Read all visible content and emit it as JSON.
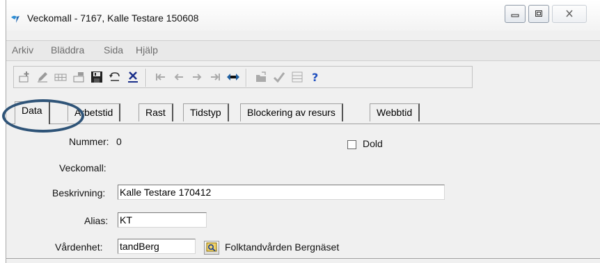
{
  "window": {
    "title": "Veckomall - 7167, Kalle Testare 150608",
    "controls": [
      "minimize-icon",
      "maximize-icon",
      "close-icon"
    ]
  },
  "menu": {
    "items": [
      "Arkiv",
      "Bläddra",
      "Sida",
      "Hjälp"
    ]
  },
  "toolbar": {
    "icons": [
      "add-record-icon",
      "edit-icon",
      "table-icon",
      "form-icon",
      "save-icon",
      "undo-icon",
      "delete-icon",
      "first-record-icon",
      "previous-icon",
      "next-icon",
      "last-record-icon",
      "swap-icon",
      "open-folder-icon",
      "checkmark-icon",
      "list-view-icon",
      "help-icon"
    ]
  },
  "tabs": [
    "Data",
    "Arbetstid",
    "Rast",
    "Tidstyp",
    "Blockering av resurs",
    "Webbtid"
  ],
  "active_tab": "Data",
  "form": {
    "nummer_label": "Nummer:",
    "nummer_value": "0",
    "dold_label": "Dold",
    "dold_checked": false,
    "veckomall_label": "Veckomall:",
    "beskrivning_label": "Beskrivning:",
    "beskrivning_value": "Kalle Testare 170412",
    "alias_label": "Alias:",
    "alias_value": "KT",
    "vardenhet_label": "Vårdenhet:",
    "vardenhet_value": "tandBerg",
    "vardenhet_name": "Folktandvården Bergnäset"
  },
  "colors": {
    "highlight_oval": "#2f5478",
    "help_icon": "#1f4fbf",
    "menu_text": "#6d6d6d"
  }
}
